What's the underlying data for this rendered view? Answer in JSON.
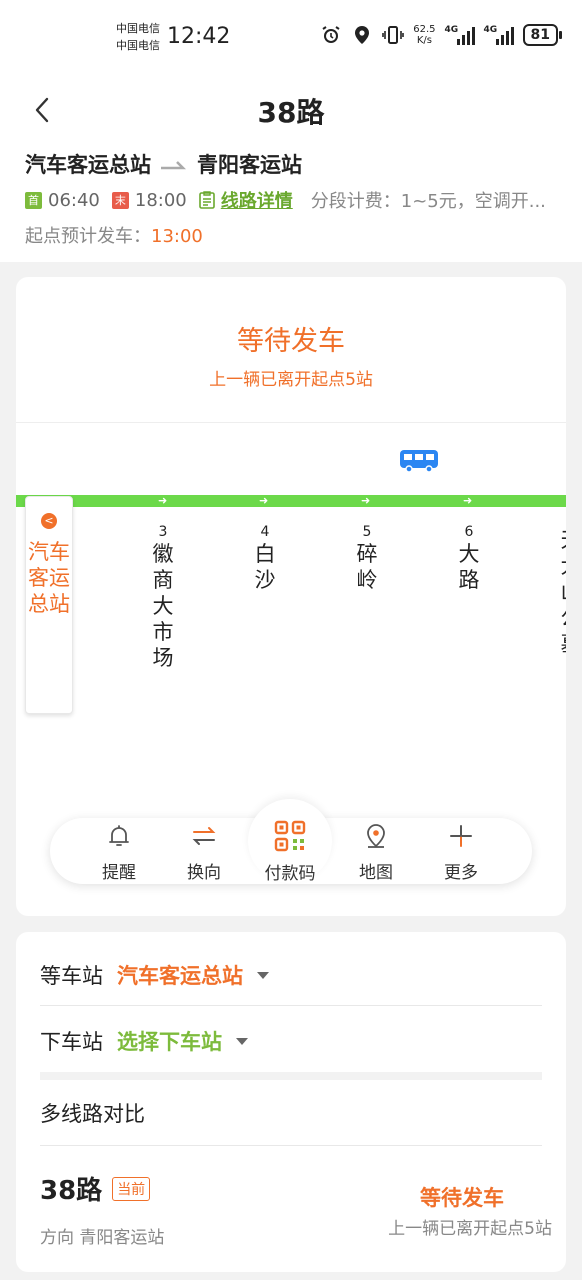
{
  "status_bar": {
    "carrier_1": "中国电信",
    "carrier_2": "中国电信",
    "time": "12:42",
    "net_speed_value": "62.5",
    "net_speed_unit": "K/s",
    "sig1_tag": "4G",
    "sig2_tag": "4G",
    "battery": "81"
  },
  "header": {
    "title": "38路",
    "from": "汽车客运总站",
    "to": "青阳客运站",
    "first_badge": "首",
    "first_time": "06:40",
    "last_badge": "末",
    "last_time": "18:00",
    "detail_link": "线路详情",
    "fare": "分段计费：1~5元，空调开...",
    "depart_label": "起点预计发车：",
    "depart_time": "13:00"
  },
  "status": {
    "title": "等待发车",
    "subtitle": "上一辆已离开起点5站"
  },
  "stops": {
    "start": {
      "dot": "<",
      "name": "汽车客运总站"
    },
    "list": [
      {
        "num": "3",
        "name": "徽商大市场"
      },
      {
        "num": "4",
        "name": "白沙"
      },
      {
        "num": "5",
        "name": "碎岭"
      },
      {
        "num": "6",
        "name": "大路"
      },
      {
        "num": "",
        "name": "天大山公墓"
      }
    ]
  },
  "toolbar": {
    "remind": "提醒",
    "switch": "换向",
    "pay": "付款码",
    "map": "地图",
    "more": "更多"
  },
  "selection": {
    "wait_label": "等车站",
    "wait_value": "汽车客运总站",
    "alight_label": "下车站",
    "alight_value": "选择下车站",
    "compare_label": "多线路对比"
  },
  "compare": {
    "line": "38路",
    "current_tag": "当前",
    "direction": "方向 青阳客运站",
    "status": "等待发车",
    "substatus": "上一辆已离开起点5站"
  },
  "colors": {
    "accent_orange": "#f0702a",
    "line_green": "#6cd94a",
    "link_green": "#7dbb3c",
    "bus_blue": "#2b86f2"
  }
}
